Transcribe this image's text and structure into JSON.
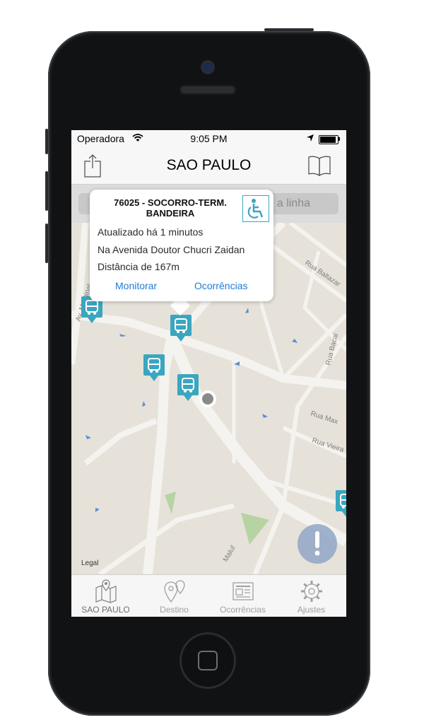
{
  "status": {
    "carrier": "Operadora",
    "time": "9:05 PM"
  },
  "nav": {
    "title": "SAO PAULO"
  },
  "search": {
    "placeholder": "a linha"
  },
  "callout": {
    "title": "76025 - SOCORRO-TERM. BANDEIRA",
    "updated": "Atualizado há 1 minutos",
    "location": "Na Avenida Doutor Chucri Zaidan",
    "distance": "Distância de 167m",
    "link_monitor": "Monitorar",
    "link_reports": "Ocorrências"
  },
  "map": {
    "legal": "Legal",
    "streets": [
      "Rua Baltazar",
      "Rua Bacai",
      "Rua Max",
      "Rua Vieira",
      "Av. Marginal",
      "Maluf"
    ]
  },
  "tabs": [
    {
      "label": "SAO PAULO",
      "icon": "map-icon",
      "active": true
    },
    {
      "label": "Destino",
      "icon": "pin-icon",
      "active": false
    },
    {
      "label": "Ocorrências",
      "icon": "newspaper-icon",
      "active": false
    },
    {
      "label": "Ajustes",
      "icon": "gear-icon",
      "active": false
    }
  ],
  "colors": {
    "accent": "#1e7bd6",
    "marker": "#3aa6bf",
    "alert": "#8fa6c6"
  }
}
